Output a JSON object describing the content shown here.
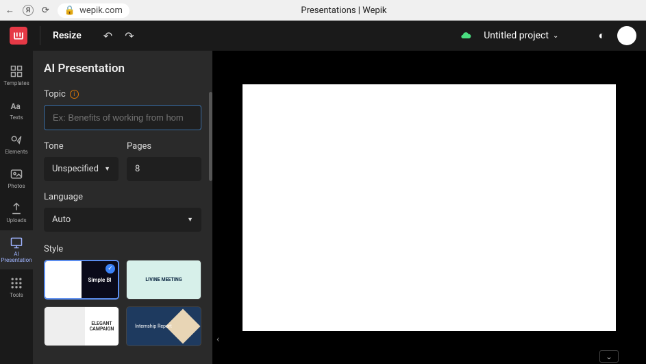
{
  "browser": {
    "url": "wepik.com",
    "tab_title": "Presentations | Wepik"
  },
  "toolbar": {
    "resize": "Resize",
    "project_name": "Untitled project"
  },
  "sidebar": {
    "items": [
      {
        "label": "Templates"
      },
      {
        "label": "Texts"
      },
      {
        "label": "Elements"
      },
      {
        "label": "Photos"
      },
      {
        "label": "Uploads"
      },
      {
        "label": "AI Presentation"
      },
      {
        "label": "Tools"
      }
    ]
  },
  "panel": {
    "title": "AI Presentation",
    "topic_label": "Topic",
    "topic_placeholder": "Ex: Benefits of working from hom",
    "tone_label": "Tone",
    "tone_value": "Unspecified",
    "pages_label": "Pages",
    "pages_value": "8",
    "language_label": "Language",
    "language_value": "Auto",
    "style_label": "Style",
    "styles": [
      {
        "name": "Simple Bl"
      },
      {
        "name": "LIVINE MEETING"
      },
      {
        "name": "ELEGANT CAMPAIGN"
      },
      {
        "name": "Internship Report"
      }
    ]
  }
}
